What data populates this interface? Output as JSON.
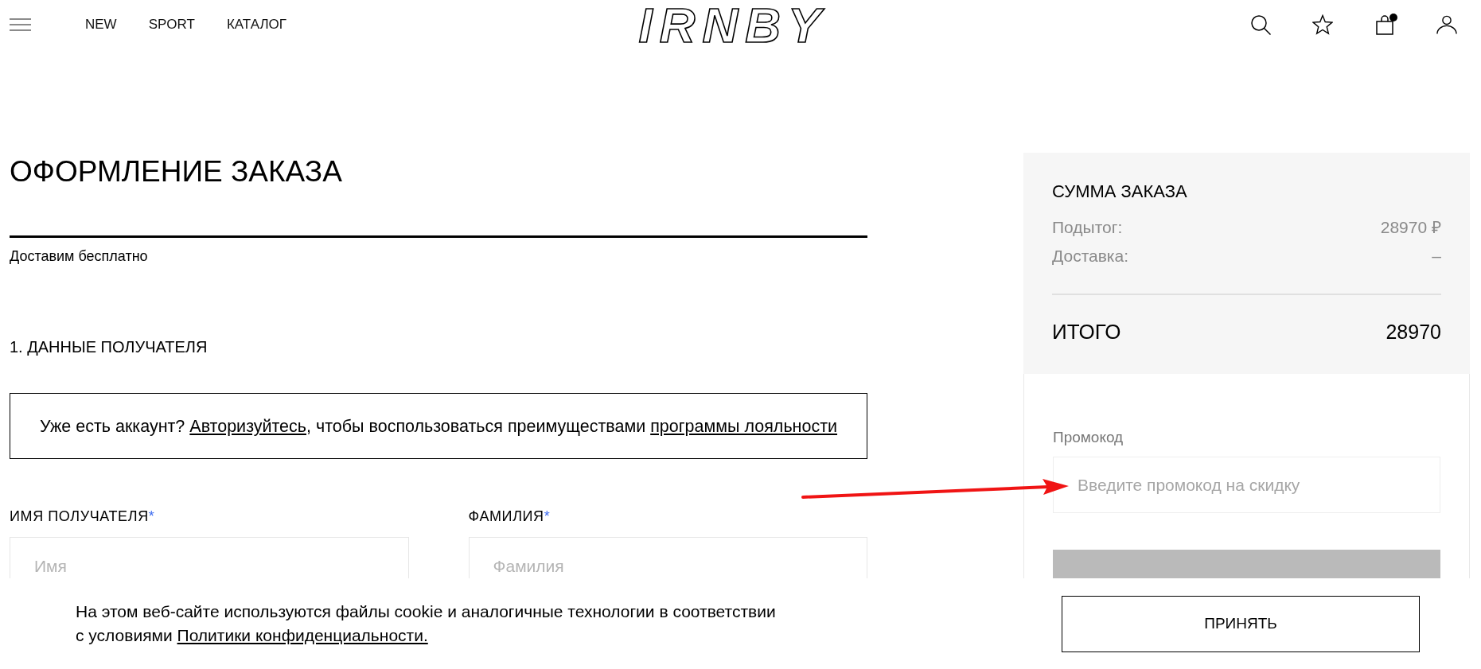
{
  "header": {
    "nav": [
      {
        "label": "NEW"
      },
      {
        "label": "SPORT"
      },
      {
        "label": "КАТАЛОГ"
      }
    ],
    "logo": "IRNBY",
    "cart_indicator": true
  },
  "checkout": {
    "title": "ОФОРМЛЕНИЕ ЗАКАЗА",
    "delivery_note": "Доставим бесплатно",
    "section_title": "1. ДАННЫЕ ПОЛУЧАТЕЛЯ",
    "login_notice": [
      {
        "kind": "text",
        "text": "Уже есть аккаунт?"
      },
      {
        "kind": "link",
        "text": "Авторизуйтесь,"
      },
      {
        "kind": "text",
        "text": "чтобы воспользоваться преимуществами"
      },
      {
        "kind": "link",
        "text": "программы лояльности"
      }
    ],
    "fields": [
      {
        "label": "ИМЯ ПОЛУЧАТЕЛЯ",
        "required_mark": "*",
        "placeholder": "Имя"
      },
      {
        "label": "ФАМИЛИЯ",
        "required_mark": "*",
        "placeholder": "Фамилия"
      }
    ]
  },
  "summary": {
    "title": "СУММА ЗАКАЗА",
    "lines": [
      {
        "label": "Подытог:",
        "value": "28970 ₽"
      },
      {
        "label": "Доставка:",
        "value": "–"
      }
    ],
    "total": {
      "label": "ИТОГО",
      "value": "28970"
    }
  },
  "promo": {
    "label": "Промокод",
    "placeholder": "Введите промокод на скидку"
  },
  "pay_button": {
    "disabled": true
  },
  "cookie_banner": {
    "text": "На этом веб-сайте используются файлы cookie и аналогичные технологии в соответствии с условиями",
    "link": "Политики конфиденциальности.",
    "button": "ПРИНЯТЬ"
  }
}
